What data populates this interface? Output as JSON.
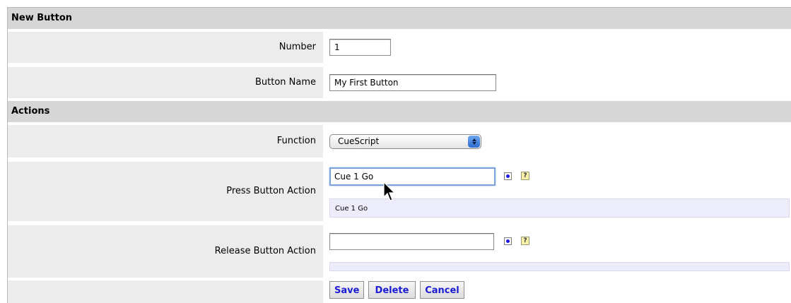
{
  "form": {
    "section_new_button": "New Button",
    "section_actions": "Actions",
    "number": {
      "label": "Number",
      "value": "1"
    },
    "button_name": {
      "label": "Button Name",
      "value": "My First Button"
    },
    "function": {
      "label": "Function",
      "selected": "CueScript"
    },
    "press_action": {
      "label": "Press Button Action",
      "value": "Cue 1 Go",
      "preview": "Cue 1 Go",
      "help": "?"
    },
    "release_action": {
      "label": "Release Button Action",
      "value": "",
      "preview": "",
      "help": "?"
    },
    "buttons": {
      "save": "Save",
      "delete": "Delete",
      "cancel": "Cancel"
    }
  },
  "icons": [
    "insert-dot-icon",
    "help-icon",
    "select-arrows-icon",
    "mouse-cursor-icon"
  ],
  "colors": {
    "section_bg": "#d6d6d6",
    "label_bg": "#ececec",
    "preview_bg": "#ececfa",
    "button_text": "#1c1cd4",
    "focus_ring": "#7ca2d9"
  }
}
